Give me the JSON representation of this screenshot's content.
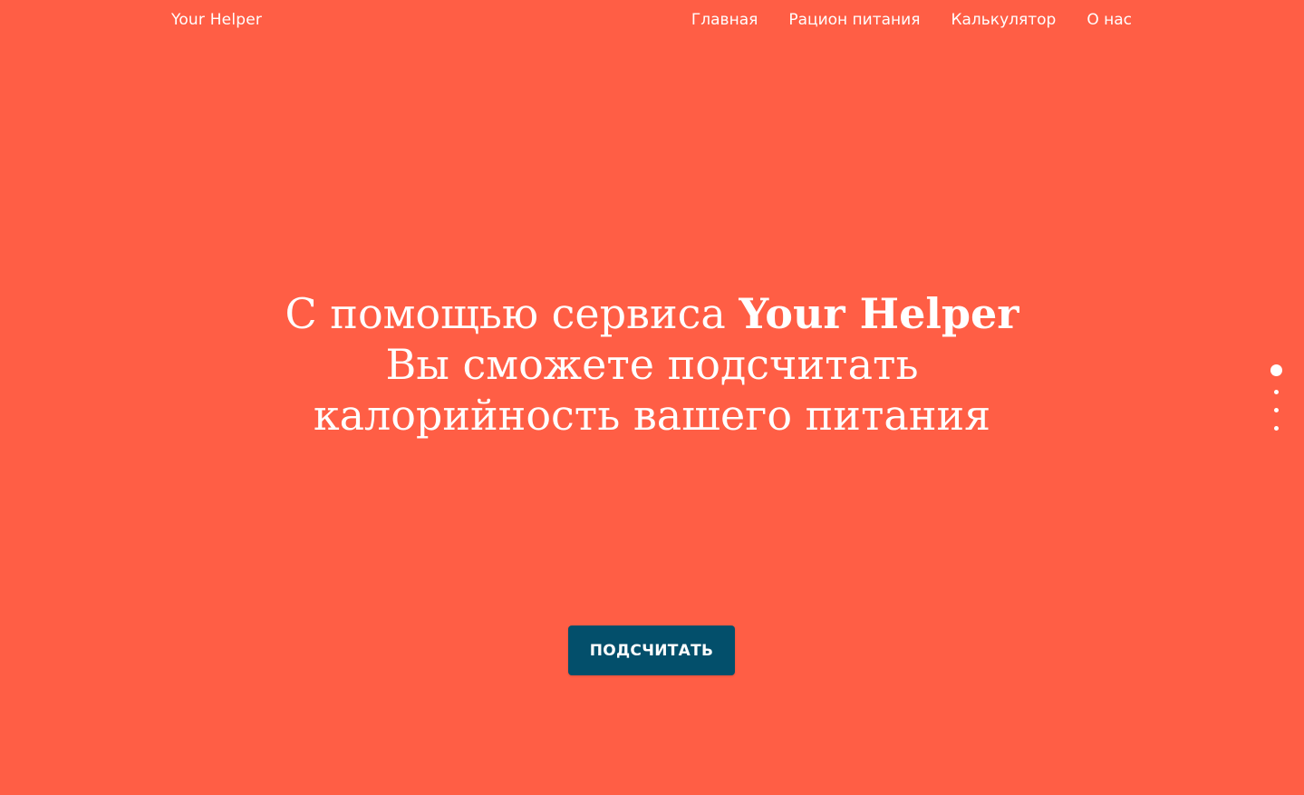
{
  "header": {
    "brand": "Your Helper",
    "nav": [
      "Главная",
      "Рацион питания",
      "Калькулятор",
      "О нас"
    ]
  },
  "hero": {
    "line1_regular": "С помощью сервиса ",
    "line1_bold": "Your Helper",
    "line2": "Вы сможете подсчитать",
    "line3": "калорийность вашего питания"
  },
  "cta": {
    "label": "ПОДСЧИТАТЬ"
  },
  "pager": {
    "total": 4,
    "active": 1
  },
  "colors": {
    "background": "#ff5e45",
    "button": "#034f6b",
    "text": "#ffffff"
  }
}
